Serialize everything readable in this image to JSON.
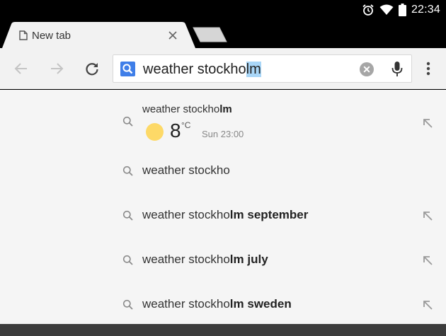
{
  "status_bar": {
    "time": "22:34",
    "icons": [
      "alarm-icon",
      "wifi-icon",
      "battery-icon"
    ]
  },
  "tabs": [
    {
      "title": "New tab",
      "active": true
    }
  ],
  "omnibox": {
    "text_before_selection": "weather stockho",
    "selected_text": "lm"
  },
  "suggestions": [
    {
      "prefix": "weather stockho",
      "bold": "lm",
      "weather": {
        "temperature": "8",
        "unit": "°C",
        "time": "Sun 23:00"
      },
      "has_refine_arrow": true
    },
    {
      "prefix": "weather stockho",
      "bold": "",
      "has_refine_arrow": false
    },
    {
      "prefix": "weather stockho",
      "bold": "lm september",
      "has_refine_arrow": true
    },
    {
      "prefix": "weather stockho",
      "bold": "lm july",
      "has_refine_arrow": true
    },
    {
      "prefix": "weather stockho",
      "bold": "lm sweden",
      "has_refine_arrow": true
    }
  ],
  "colors": {
    "accent_blue": "#3f7ee8",
    "selection": "#a9d6f7",
    "sun": "#fdd967",
    "toolbar": "#f2f2f2"
  }
}
